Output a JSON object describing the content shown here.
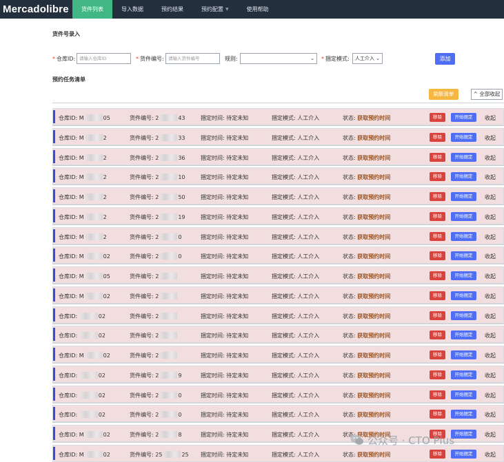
{
  "nav": {
    "brand": "Mercadolibre",
    "items": [
      {
        "label": "货件列表",
        "active": true
      },
      {
        "label": "导入数据",
        "active": false
      },
      {
        "label": "预约结果",
        "active": false
      },
      {
        "label": "预约配置",
        "active": false,
        "has_dropdown": true
      },
      {
        "label": "使用帮助",
        "active": false
      }
    ]
  },
  "entry": {
    "title": "货件号录入",
    "warehouse_label": "仓库ID:",
    "warehouse_placeholder": "请输入仓库ID",
    "shipment_label": "货件编号:",
    "shipment_placeholder": "请输入货件编号",
    "rule_label": "规则:",
    "rule_value": "",
    "mode_label": "捆定模式:",
    "mode_value": "人工介入",
    "add_button": "添加"
  },
  "tasks": {
    "title": "预约任务清单",
    "refresh_button": "刷新清单",
    "collapse_all_button": "全部收起",
    "collapse_all_icon": "chevron-up-icon",
    "labels": {
      "warehouse": "仓库ID:",
      "shipment": "货件编号:",
      "bind_time": "捆定时间:",
      "bind_time_value": "待定未知",
      "bind_mode": "捆定模式:",
      "bind_mode_value": "人工介入",
      "status": "状态:",
      "status_value": "获取预约时间",
      "remove": "移除",
      "start": "开始捆定",
      "fold": "收起"
    },
    "rows": [
      {
        "warehouse_prefix": "M",
        "warehouse_suffix": "05",
        "shipment_prefix": "2",
        "shipment_suffix": "43"
      },
      {
        "warehouse_prefix": "M",
        "warehouse_suffix": "2",
        "shipment_prefix": "2",
        "shipment_suffix": "33"
      },
      {
        "warehouse_prefix": "M",
        "warehouse_suffix": "2",
        "shipment_prefix": "2",
        "shipment_suffix": "36"
      },
      {
        "warehouse_prefix": "M",
        "warehouse_suffix": "2",
        "shipment_prefix": "2",
        "shipment_suffix": "10"
      },
      {
        "warehouse_prefix": "M",
        "warehouse_suffix": "2",
        "shipment_prefix": "2",
        "shipment_suffix": "50"
      },
      {
        "warehouse_prefix": "M",
        "warehouse_suffix": "2",
        "shipment_prefix": "2",
        "shipment_suffix": "19"
      },
      {
        "warehouse_prefix": "M",
        "warehouse_suffix": "2",
        "shipment_prefix": "2",
        "shipment_suffix": "0"
      },
      {
        "warehouse_prefix": "M",
        "warehouse_suffix": "02",
        "shipment_prefix": "2",
        "shipment_suffix": "0"
      },
      {
        "warehouse_prefix": "M",
        "warehouse_suffix": "05",
        "shipment_prefix": "2",
        "shipment_suffix": ""
      },
      {
        "warehouse_prefix": "M",
        "warehouse_suffix": "02",
        "shipment_prefix": "2",
        "shipment_suffix": ""
      },
      {
        "warehouse_prefix": "",
        "warehouse_suffix": "02",
        "shipment_prefix": "2",
        "shipment_suffix": ""
      },
      {
        "warehouse_prefix": "",
        "warehouse_suffix": "02",
        "shipment_prefix": "2",
        "shipment_suffix": ""
      },
      {
        "warehouse_prefix": "M",
        "warehouse_suffix": "02",
        "shipment_prefix": "2",
        "shipment_suffix": ""
      },
      {
        "warehouse_prefix": "",
        "warehouse_suffix": "02",
        "shipment_prefix": "2",
        "shipment_suffix": "9"
      },
      {
        "warehouse_prefix": "",
        "warehouse_suffix": "02",
        "shipment_prefix": "2",
        "shipment_suffix": "0"
      },
      {
        "warehouse_prefix": "",
        "warehouse_suffix": "02",
        "shipment_prefix": "2",
        "shipment_suffix": "0"
      },
      {
        "warehouse_prefix": "M",
        "warehouse_suffix": "02",
        "shipment_prefix": "2",
        "shipment_suffix": "8"
      },
      {
        "warehouse_prefix": "M",
        "warehouse_suffix": "02",
        "shipment_prefix": "25",
        "shipment_suffix": "25"
      }
    ]
  },
  "watermark": {
    "text": "公众号 · CTO Plus",
    "icon": "wechat-icon"
  },
  "colors": {
    "nav_bg": "#242f3e",
    "nav_active": "#41b883",
    "row_bg": "#f2dede",
    "row_accent": "#3a4bd6",
    "primary": "#4f6df5",
    "danger": "#d9433d",
    "warning": "#f5b642",
    "status_text": "#a0521a"
  }
}
